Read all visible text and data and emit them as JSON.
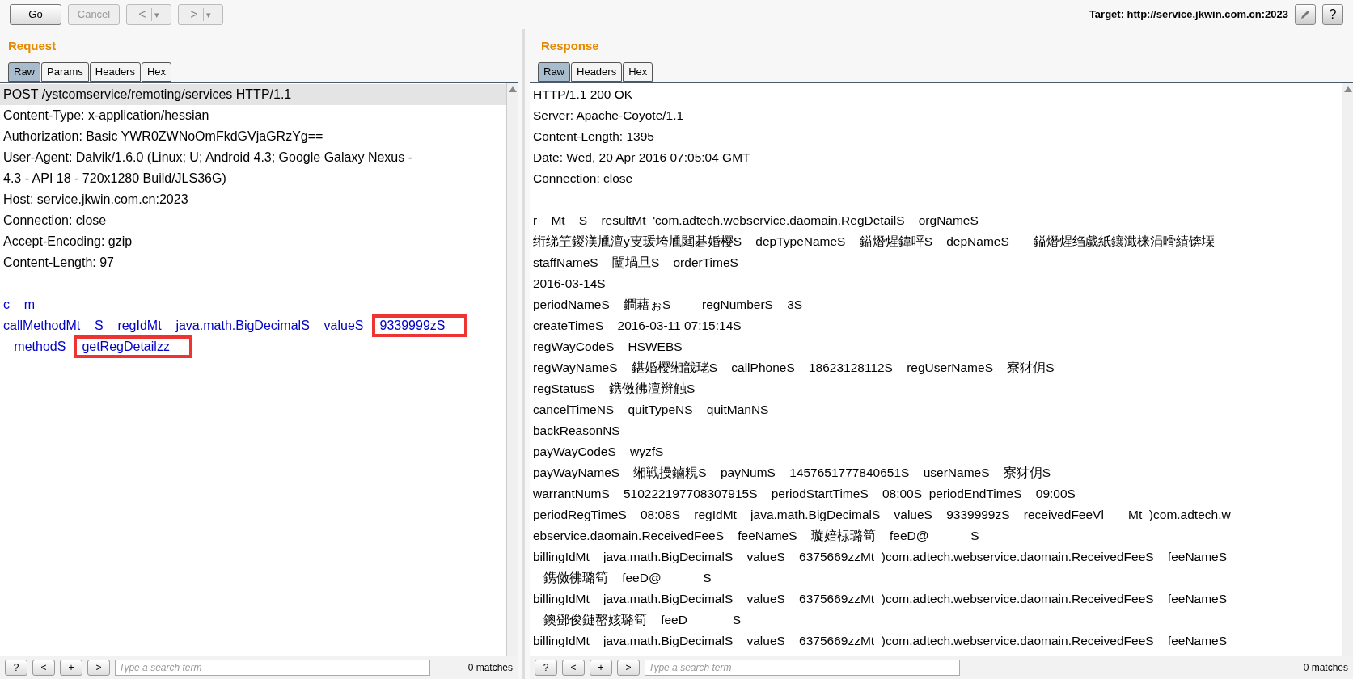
{
  "toolbar": {
    "buttons": [
      {
        "label": "Go",
        "disabled": false
      },
      {
        "label": "Cancel",
        "disabled": true
      }
    ],
    "history": [
      {
        "label": "<",
        "menu": "▾"
      },
      {
        "label": ">",
        "menu": "▾"
      }
    ],
    "target": "Target: http://service.jkwin.com.cn:2023",
    "help": "?"
  },
  "request": {
    "title": "Request",
    "tabs": [
      {
        "label": "Raw",
        "selected": true
      },
      {
        "label": "Params",
        "selected": false
      },
      {
        "label": "Headers",
        "selected": false
      },
      {
        "label": "Hex",
        "selected": false
      }
    ],
    "lines": [
      {
        "kind": "header",
        "current": true,
        "segments": [
          {
            "text": "POST /ystcomservice/remoting/services HTTP/1.1",
            "boxed": false
          }
        ]
      },
      {
        "kind": "header",
        "current": false,
        "segments": [
          {
            "text": "Content-Type: x-application/hessian",
            "boxed": false
          }
        ]
      },
      {
        "kind": "header",
        "current": false,
        "segments": [
          {
            "text": "Authorization: Basic YWR0ZWNoOmFkdGVjaGRzYg==",
            "boxed": false
          }
        ]
      },
      {
        "kind": "header",
        "current": false,
        "segments": [
          {
            "text": "User-Agent: Dalvik/1.6.0 (Linux; U; Android 4.3; Google Galaxy Nexus -",
            "boxed": false
          }
        ]
      },
      {
        "kind": "header",
        "current": false,
        "segments": [
          {
            "text": "4.3 - API 18 - 720x1280 Build/JLS36G)",
            "boxed": false
          }
        ]
      },
      {
        "kind": "header",
        "current": false,
        "segments": [
          {
            "text": "Host: service.jkwin.com.cn:2023",
            "boxed": false
          }
        ]
      },
      {
        "kind": "header",
        "current": false,
        "segments": [
          {
            "text": "Connection: close",
            "boxed": false
          }
        ]
      },
      {
        "kind": "header",
        "current": false,
        "segments": [
          {
            "text": "Accept-Encoding: gzip",
            "boxed": false
          }
        ]
      },
      {
        "kind": "header",
        "current": false,
        "segments": [
          {
            "text": "Content-Length: 97",
            "boxed": false
          }
        ]
      },
      {
        "kind": "blank",
        "current": false
      },
      {
        "kind": "body",
        "current": false,
        "segments": [
          {
            "text": "c    m",
            "boxed": false
          }
        ]
      },
      {
        "kind": "body",
        "current": false,
        "segments": [
          {
            "text": "callMethodMt    S    regIdMt    java.math.BigDecimalS    valueS",
            "boxed": false
          },
          {
            "text": "9339999zS",
            "boxed": true
          }
        ]
      },
      {
        "kind": "body",
        "current": false,
        "segments": [
          {
            "text": "   methodS",
            "boxed": false
          },
          {
            "text": "getRegDetailzz",
            "boxed": true
          }
        ]
      }
    ],
    "search": {
      "buttons": [
        "?",
        "<",
        "+",
        ">"
      ],
      "placeholder": "Type a search term",
      "matches": "0 matches"
    }
  },
  "response": {
    "title": "Response",
    "tabs": [
      {
        "label": "Raw",
        "selected": true
      },
      {
        "label": "Headers",
        "selected": false
      },
      {
        "label": "Hex",
        "selected": false
      }
    ],
    "headers": [
      "HTTP/1.1 200 OK",
      "Server: Apache-Coyote/1.1",
      "Content-Length: 1395",
      "Date: Wed, 20 Apr 2016 07:05:04 GMT",
      "Connection: close"
    ],
    "body": [
      "r    Mt    S    resultMt  'com.adtech.webservice.daomain.RegDetailS    orgNameS",
      "绗绨笁鍐渼尰澶у叓瑗垮尰閮碁婚樱S    depTypeNameS    鎰熸煋鍏呯S    depNameS       鎰熸煋绉戱紙鑲濈梾涓嗗績锛塛",
      "staffNameS    闉堝旦S    orderTimeS",
      "2016-03-14S",
      "periodNameS    鐧藉ぉS         regNumberS    3S",
      "createTimeS    2016-03-11 07:15:14S",
      "regWayCodeS    HSWEBS",
      "regWayNameS    鍖婚樱缃戠珯S    callPhoneS    18623128112S    regUserNameS    寮犲仴S",
      "regStatusS    鎸傚彿澶辫触S",
      "cancelTimeNS    quitTypeNS    quitManNS",
      "backReasonNS",
      "payWayCodeS    wyzfS",
      "payWayNameS    缃戦摱鏀粯S    payNumS    1457651777840651S    userNameS    寮犲仴S",
      "warrantNumS    510222197708307915S    periodStartTimeS    08:00S  periodEndTimeS    09:00S",
      "periodRegTimeS    08:08S    regIdMt    java.math.BigDecimalS    valueS    9339999zS    receivedFeeVl       Mt  )com.adtech.w",
      "ebservice.daomain.ReceivedFeeS    feeNameS    璇婄柡璐筍    feeD@            S",
      "billingIdMt    java.math.BigDecimalS    valueS    6375669zzMt  )com.adtech.webservice.daomain.ReceivedFeeS    feeNameS",
      "   鎸傚彿璐筍    feeD@            S",
      "billingIdMt    java.math.BigDecimalS    valueS    6375669zzMt  )com.adtech.webservice.daomain.ReceivedFeeS    feeNameS",
      "   鐭鄧俊鏈嶅姟璐筍    feeD             S",
      "billingIdMt    java.math.BigDecimalS    valueS    6375669zzMt  )com.adtech.webservice.daomain.ReceivedFeeS    feeNameS"
    ],
    "search": {
      "buttons": [
        "?",
        "<",
        "+",
        ">"
      ],
      "placeholder": "Type a search term",
      "matches": "0 matches"
    }
  }
}
